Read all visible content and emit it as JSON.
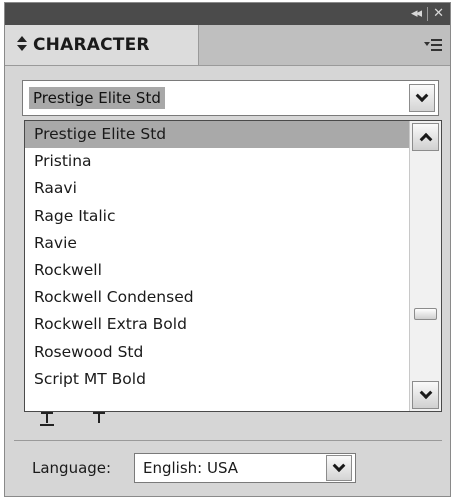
{
  "panel": {
    "title": "CHARACTER"
  },
  "font_family": {
    "selected": "Prestige Elite Std",
    "options": [
      "Prestige Elite Std",
      "Pristina",
      "Raavi",
      "Rage Italic",
      "Ravie",
      "Rockwell",
      "Rockwell Condensed",
      "Rockwell Extra Bold",
      "Rosewood Std",
      "Script MT Bold"
    ]
  },
  "language": {
    "label": "Language:",
    "value": "English: USA"
  }
}
